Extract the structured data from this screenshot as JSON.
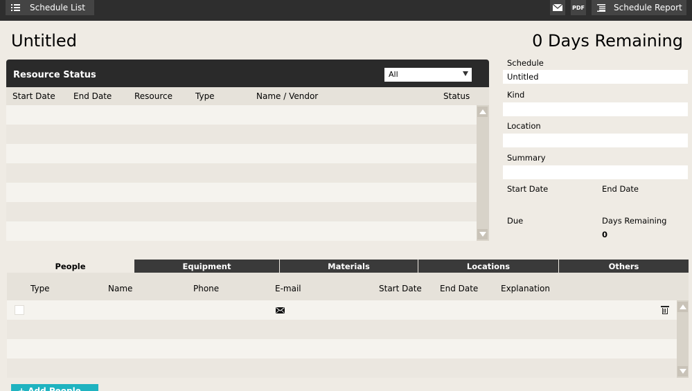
{
  "topbar": {
    "schedule_list_label": "Schedule List",
    "pdf_label": "PDF",
    "schedule_report_label": "Schedule Report"
  },
  "page": {
    "title": "Untitled",
    "days_remaining_title": "0 Days Remaining"
  },
  "resource_status": {
    "title": "Resource Status",
    "filter_value": "All",
    "columns": [
      "Start Date",
      "End Date",
      "Resource",
      "Type",
      "Name / Vendor",
      "Status"
    ],
    "rows": []
  },
  "form": {
    "schedule_label": "Schedule",
    "schedule_value": "Untitled",
    "kind_label": "Kind",
    "kind_value": "",
    "location_label": "Location",
    "location_value": "",
    "summary_label": "Summary",
    "summary_value": "",
    "start_date_label": "Start Date",
    "end_date_label": "End Date",
    "due_label": "Due",
    "days_remaining_label": "Days Remaining",
    "days_remaining_value": "0"
  },
  "tabs": [
    "People",
    "Equipment",
    "Materials",
    "Locations",
    "Others"
  ],
  "people": {
    "columns": [
      "Type",
      "Name",
      "Phone",
      "E-mail",
      "Start Date",
      "End Date",
      "Explanation"
    ],
    "add_button": "+ Add People"
  },
  "colors": {
    "topbar": "#2e2e2e",
    "background": "#efebe4",
    "accent": "#1fb3c0"
  }
}
